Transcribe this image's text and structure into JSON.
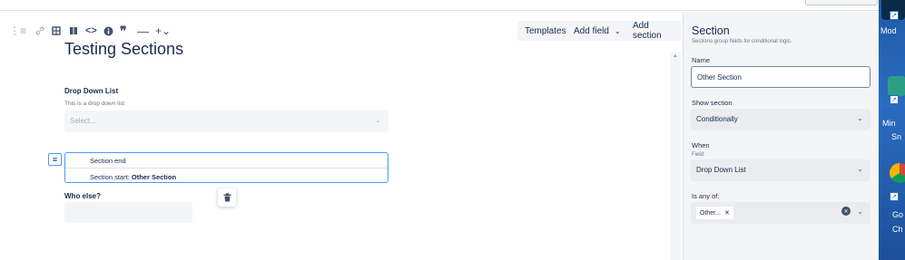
{
  "toolbar": {
    "icons": [
      "list-icon",
      "link-icon",
      "table-icon",
      "columns-icon",
      "code-icon",
      "info-icon",
      "quote-icon",
      "divider-icon",
      "add-more-icon"
    ],
    "templates_label": "Templates",
    "add_field_label": "Add field",
    "add_section_label": "Add section"
  },
  "form": {
    "title": "Testing Sections",
    "dropdown": {
      "label": "Drop Down List",
      "help": "This is a drop down list",
      "placeholder": "Select..."
    },
    "section": {
      "end_label": "Section end",
      "start_prefix": "Section start:",
      "start_name": "Other Section"
    },
    "who_else": {
      "label": "Who else?"
    }
  },
  "panel": {
    "title": "Section",
    "subtitle": "Sections group fields for conditional logic.",
    "name_label": "Name",
    "name_value": "Other Section",
    "show_label": "Show section",
    "show_value": "Conditionally",
    "when_label": "When",
    "field_label": "Field:",
    "field_value": "Drop Down List",
    "is_any_of_label": "Is any of:",
    "tag_value": "Other..."
  },
  "desktop": {
    "labels": [
      "Mod",
      "Min",
      "Sn",
      "Go",
      "Ch"
    ]
  },
  "colors": {
    "accent": "#4c9aff",
    "panel_bg": "#f4f5f7",
    "desktop_bg": "#2a6cc0"
  }
}
